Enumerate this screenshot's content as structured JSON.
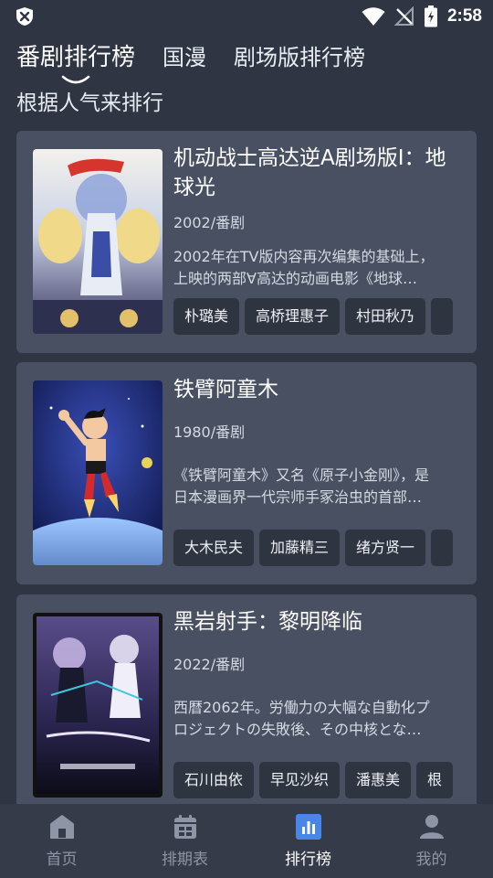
{
  "status_bar": {
    "time": "2:58"
  },
  "tabs": [
    {
      "label": "番剧排行榜",
      "active": true
    },
    {
      "label": "国漫",
      "active": false
    },
    {
      "label": "剧场版排行榜",
      "active": false
    }
  ],
  "subtitle": "根据人气来排行",
  "cards": [
    {
      "title": "机动战士高达逆A剧场版I：地球光",
      "meta": "2002/番剧",
      "desc_line1": "2002年在TV版内容再次编集的基础上，",
      "desc_line2": "上映的两部∀高达的动画电影《地球…",
      "cast": [
        "朴璐美",
        "高桥理惠子",
        "村田秋乃",
        ""
      ]
    },
    {
      "title": "铁臂阿童木",
      "meta": "1980/番剧",
      "desc_line1": "《铁臂阿童木》又名《原子小金刚》，是",
      "desc_line2": "日本漫画界一代宗师手冢治虫的首部…",
      "cast": [
        "大木民夫",
        "加藤精三",
        "绪方贤一",
        ""
      ]
    },
    {
      "title": "黑岩射手：黎明降临",
      "meta": "2022/番剧",
      "desc_line1": "西暦2062年。労働力の大幅な自動化プ",
      "desc_line2": "ロジェクトの失敗後、その中核とな…",
      "cast": [
        "石川由依",
        "早见沙织",
        "潘惠美",
        "根"
      ]
    }
  ],
  "nav": [
    {
      "label": "首页",
      "icon": "home-icon",
      "active": false
    },
    {
      "label": "排期表",
      "icon": "calendar-icon",
      "active": false
    },
    {
      "label": "排行榜",
      "icon": "ranking-icon",
      "active": true
    },
    {
      "label": "我的",
      "icon": "profile-icon",
      "active": false
    }
  ],
  "colors": {
    "background": "#2f3542",
    "card": "#485062",
    "chip": "#2e3440",
    "accent": "#4a86e8",
    "nav_inactive": "#8e96a6"
  }
}
